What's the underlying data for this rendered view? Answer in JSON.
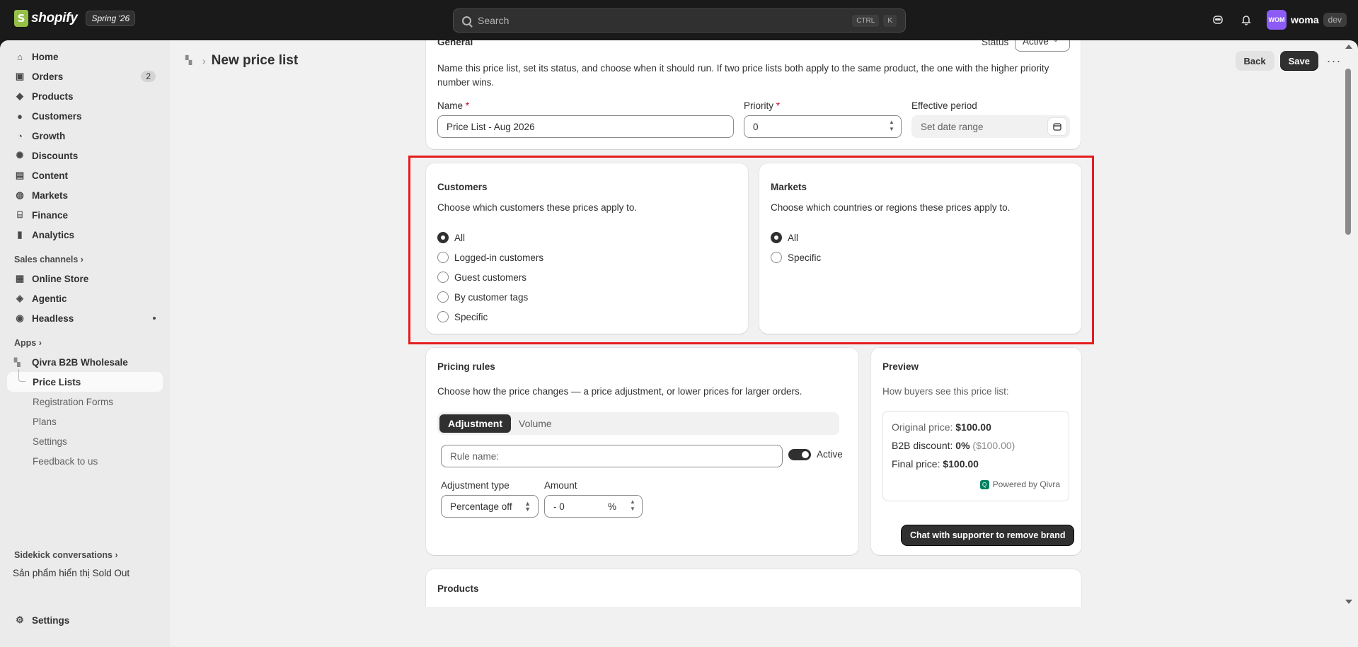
{
  "topbar": {
    "logo_glyph": "S",
    "logo_text": "shopify",
    "edition": "Spring '26",
    "search_placeholder": "Search",
    "kbd_ctrl": "CTRL",
    "kbd_k": "K",
    "account_initials": "WOM",
    "account_name": "woma",
    "account_tag": "dev"
  },
  "sidebar": {
    "items": [
      {
        "label": "Home",
        "icon": "home-icon"
      },
      {
        "label": "Orders",
        "icon": "orders-icon",
        "badge": "2"
      },
      {
        "label": "Products",
        "icon": "tag-icon"
      },
      {
        "label": "Customers",
        "icon": "person-icon"
      },
      {
        "label": "Growth",
        "icon": "growth-icon"
      },
      {
        "label": "Discounts",
        "icon": "discount-icon"
      },
      {
        "label": "Content",
        "icon": "content-icon"
      },
      {
        "label": "Markets",
        "icon": "globe-icon"
      },
      {
        "label": "Finance",
        "icon": "bank-icon"
      },
      {
        "label": "Analytics",
        "icon": "chart-icon"
      }
    ],
    "sales_channels_label": "Sales channels",
    "channels": [
      {
        "label": "Online Store",
        "icon": "store-icon"
      },
      {
        "label": "Agentic",
        "icon": "agentic-icon"
      },
      {
        "label": "Headless",
        "icon": "headless-icon"
      }
    ],
    "apps_label": "Apps",
    "app_name": "Qivra B2B Wholesale",
    "app_sub": [
      "Price Lists",
      "Registration Forms",
      "Plans",
      "Settings",
      "Feedback to us"
    ],
    "sidekick_label": "Sidekick conversations",
    "sidekick_item": "Sản phẩm hiển thị Sold Out",
    "settings_label": "Settings"
  },
  "header": {
    "title": "New price list",
    "back": "Back",
    "save": "Save"
  },
  "general": {
    "title": "General",
    "status_label": "Status",
    "status_value": "Active",
    "description": "Name this price list, set its status, and choose when it should run. If two price lists both apply to the same product, the one with the higher priority number wins.",
    "name_label": "Name",
    "name_value": "Price List - Aug 2026",
    "priority_label": "Priority",
    "priority_value": "0",
    "period_label": "Effective period",
    "period_placeholder": "Set date range",
    "required_mark": "*"
  },
  "customers": {
    "title": "Customers",
    "description": "Choose which customers these prices apply to.",
    "options": [
      "All",
      "Logged-in customers",
      "Guest customers",
      "By customer tags",
      "Specific"
    ],
    "selected": "All"
  },
  "markets": {
    "title": "Markets",
    "description": "Choose which countries or regions these prices apply to.",
    "options": [
      "All",
      "Specific"
    ],
    "selected": "All"
  },
  "pricing": {
    "title": "Pricing rules",
    "description": "Choose how the price changes — a price adjustment, or lower prices for larger orders.",
    "tab_adjustment": "Adjustment",
    "tab_volume": "Volume",
    "rule_name_placeholder": "Rule name:",
    "active_label": "Active",
    "adj_type_label": "Adjustment type",
    "adj_type_value": "Percentage off",
    "amount_label": "Amount",
    "amount_value": "- 0",
    "amount_unit": "%"
  },
  "preview": {
    "title": "Preview",
    "description": "How buyers see this price list:",
    "original_label": "Original price:",
    "original_value": "$100.00",
    "discount_label": "B2B discount:",
    "discount_value": "0%",
    "discount_paren": "($100.00)",
    "final_label": "Final price:",
    "final_value": "$100.00",
    "powered": "Powered by Qivra",
    "chat_button": "Chat with supporter to remove brand"
  },
  "products": {
    "title": "Products"
  },
  "colors": {
    "highlight": "#e51c1c",
    "dark": "#303030"
  }
}
